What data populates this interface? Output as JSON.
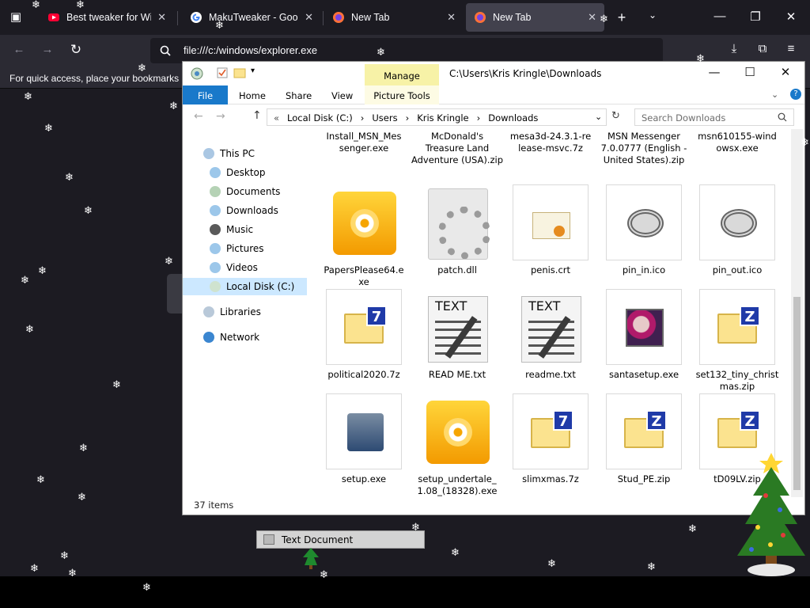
{
  "browser": {
    "tabs": [
      {
        "title": "Best tweaker for Windo",
        "favicon": "youtube-icon",
        "active": false
      },
      {
        "title": "MakuTweaker - Google",
        "favicon": "google-icon",
        "active": false
      },
      {
        "title": "New Tab",
        "favicon": "firefox-icon",
        "active": false
      },
      {
        "title": "New Tab",
        "favicon": "firefox-icon",
        "active": true
      }
    ],
    "url": "file:///c:/windows/explorer.exe",
    "bookmarks_hint": "For quick access, place your bookmarks h"
  },
  "explorer": {
    "title_path": "C:\\Users\\Kris Kringle\\Downloads",
    "manage_label": "Manage",
    "ribbon": {
      "file": "File",
      "home": "Home",
      "share": "Share",
      "view": "View",
      "picture_tools": "Picture Tools"
    },
    "breadcrumbs": [
      "Local Disk (C:)",
      "Users",
      "Kris Kringle",
      "Downloads"
    ],
    "search_placeholder": "Search Downloads",
    "nav_items": [
      {
        "label": "This PC",
        "icon": "this-pc-icon"
      },
      {
        "label": "Desktop",
        "icon": "desktop-icon"
      },
      {
        "label": "Documents",
        "icon": "documents-icon"
      },
      {
        "label": "Downloads",
        "icon": "downloads-icon"
      },
      {
        "label": "Music",
        "icon": "music-icon"
      },
      {
        "label": "Pictures",
        "icon": "pictures-icon"
      },
      {
        "label": "Videos",
        "icon": "videos-icon"
      },
      {
        "label": "Local Disk (C:)",
        "icon": "local-disk-icon"
      },
      {
        "label": "Libraries",
        "icon": "libraries-icon"
      },
      {
        "label": "Network",
        "icon": "network-icon"
      }
    ],
    "files_top": [
      "Install_MSN_Mes senger.exe",
      "McDonald's Treasure Land Adventure (USA).zip",
      "mesa3d-24.3.1-re lease-msvc.7z",
      "MSN Messenger 7.0.0777 (English - United States).zip",
      "msn610155-wind owsx.exe"
    ],
    "files": [
      {
        "name": "PapersPlease64.e xe",
        "icon": "disc-icon"
      },
      {
        "name": "patch.dll",
        "icon": "dll-icon"
      },
      {
        "name": "penis.crt",
        "icon": "certificate-icon"
      },
      {
        "name": "pin_in.ico",
        "icon": "ico-file-icon"
      },
      {
        "name": "pin_out.ico",
        "icon": "ico-file-icon"
      },
      {
        "name": "political2020.7z",
        "icon": "7z-archive-icon"
      },
      {
        "name": "READ ME.txt",
        "icon": "text-file-icon"
      },
      {
        "name": "readme.txt",
        "icon": "text-file-icon"
      },
      {
        "name": "santasetup.exe",
        "icon": "santa-exe-icon"
      },
      {
        "name": "set132_tiny_christ mas.zip",
        "icon": "zip-archive-icon"
      },
      {
        "name": "setup.exe",
        "icon": "setup-exe-icon"
      },
      {
        "name": "setup_undertale_ 1.08_(18328).exe",
        "icon": "disc-icon"
      },
      {
        "name": "slimxmas.7z",
        "icon": "7z-archive-icon"
      },
      {
        "name": "Stud_PE.zip",
        "icon": "zip-archive-icon"
      },
      {
        "name": "tD09LV.zip",
        "icon": "zip-archive-icon"
      }
    ],
    "status": "37 items"
  },
  "tooltip": {
    "label": "Text Document"
  },
  "colors": {
    "accent": "#1979ca",
    "manage": "#f7f2a7",
    "selection": "#cce8ff"
  }
}
